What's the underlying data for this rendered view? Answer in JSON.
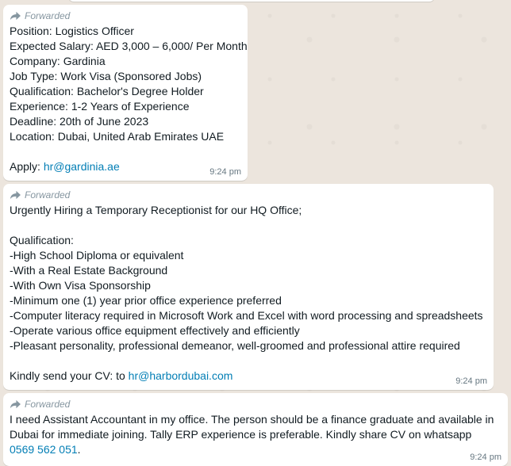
{
  "forwarded_label": "Forwarded",
  "messages": [
    {
      "lines": [
        "Position: Logistics Officer",
        "Expected Salary: AED 3,000 – 6,000/ Per Month",
        "Company: Gardinia",
        "Job Type: Work Visa (Sponsored Jobs)",
        "Qualification: Bachelor's Degree Holder",
        "Experience: 1-2 Years of Experience",
        "Deadline: 20th of June 2023",
        "Location: Dubai, United Arab Emirates UAE"
      ],
      "apply_prefix": "Apply: ",
      "apply_link": "hr@gardinia.ae",
      "time": "9:24 pm"
    },
    {
      "lines": [
        "Urgently Hiring a Temporary Receptionist for our HQ Office;",
        "Qualification:",
        "-High School Diploma or equivalent",
        "-With a Real Estate Background",
        "-With Own Visa Sponsorship",
        "-Minimum one (1) year prior office experience preferred",
        "-Computer literacy required in Microsoft Work and Excel with word processing and spreadsheets",
        "-Operate various office equipment effectively and efficiently",
        "-Pleasant personality, professional demeanor, well-groomed and professional attire required"
      ],
      "cv_prefix": "Kindly send your CV: to ",
      "cv_link": "hr@harbordubai.com",
      "time": "9:24 pm"
    },
    {
      "text": "I need Assistant Accountant in my office. The person should be a finance graduate and available in Dubai for immediate joining. Tally ERP experience is preferable. Kindly share CV on whatsapp ",
      "phone_link": "0569 562 051",
      "suffix": ".",
      "time": "9:24 pm"
    }
  ]
}
